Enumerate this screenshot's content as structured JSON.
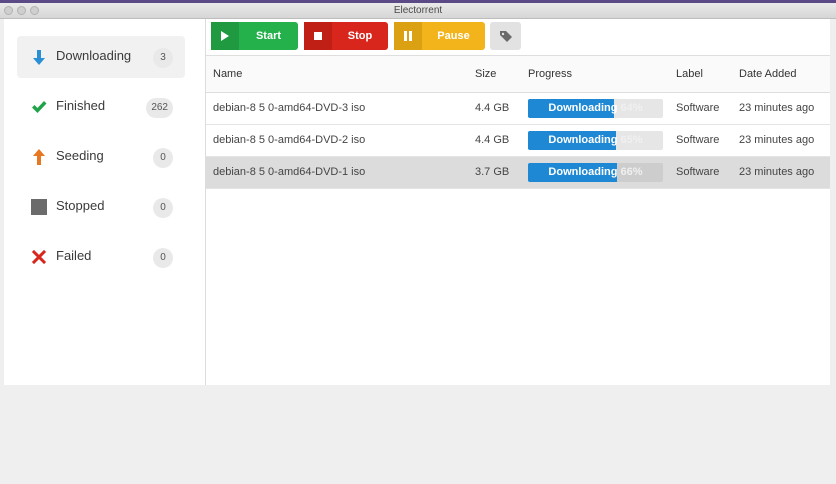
{
  "window": {
    "title": "Electorrent"
  },
  "colors": {
    "accent": "#1e88d4",
    "start": "#24b04b",
    "stop": "#d9261c",
    "pause": "#f3b31b"
  },
  "sidebar": {
    "items": [
      {
        "label": "Downloading",
        "count": "3",
        "icon": "arrow-down-icon",
        "active": true
      },
      {
        "label": "Finished",
        "count": "262",
        "icon": "checkmark-icon"
      },
      {
        "label": "Seeding",
        "count": "0",
        "icon": "arrow-up-icon"
      },
      {
        "label": "Stopped",
        "count": "0",
        "icon": "stop-square-icon"
      },
      {
        "label": "Failed",
        "count": "0",
        "icon": "x-icon"
      }
    ]
  },
  "toolbar": {
    "start_label": "Start",
    "stop_label": "Stop",
    "pause_label": "Pause",
    "label_button_icon": "tag-icon"
  },
  "table": {
    "headers": {
      "name": "Name",
      "size": "Size",
      "progress": "Progress",
      "label": "Label",
      "date": "Date Added"
    },
    "rows": [
      {
        "name": "debian-8 5 0-amd64-DVD-3 iso",
        "size": "4.4 GB",
        "status": "Downloading",
        "percent": "64%",
        "progress": 0.64,
        "label": "Software",
        "date": "23 minutes ago",
        "selected": false
      },
      {
        "name": "debian-8 5 0-amd64-DVD-2 iso",
        "size": "4.4 GB",
        "status": "Downloading",
        "percent": "65%",
        "progress": 0.65,
        "label": "Software",
        "date": "23 minutes ago",
        "selected": false
      },
      {
        "name": "debian-8 5 0-amd64-DVD-1 iso",
        "size": "3.7 GB",
        "status": "Downloading",
        "percent": "66%",
        "progress": 0.66,
        "label": "Software",
        "date": "23 minutes ago",
        "selected": true
      }
    ]
  }
}
